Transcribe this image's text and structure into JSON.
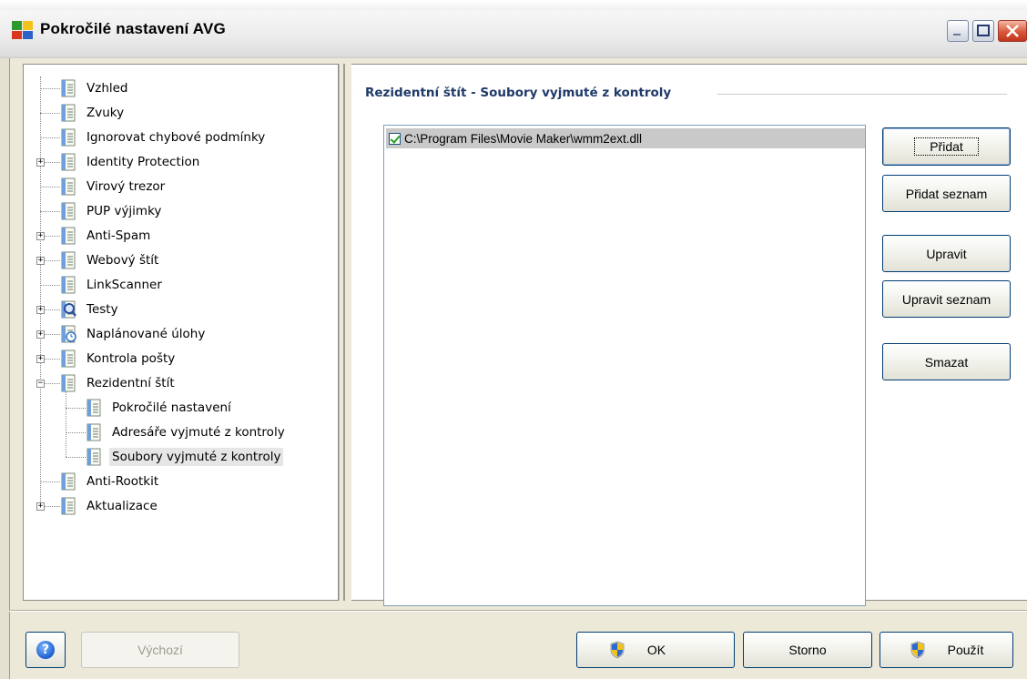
{
  "window": {
    "title": "Pokročilé nastavení AVG"
  },
  "tree": {
    "items": [
      {
        "label": "Vzhled",
        "level": 0,
        "icon": "settings-page-icon",
        "expandable": false
      },
      {
        "label": "Zvuky",
        "level": 0,
        "icon": "settings-page-icon",
        "expandable": false
      },
      {
        "label": "Ignorovat chybové podmínky",
        "level": 0,
        "icon": "settings-page-icon",
        "expandable": false
      },
      {
        "label": "Identity Protection",
        "level": 0,
        "icon": "settings-page-icon",
        "expandable": true,
        "expanded": false
      },
      {
        "label": "Virový trezor",
        "level": 0,
        "icon": "settings-page-icon",
        "expandable": false
      },
      {
        "label": "PUP výjimky",
        "level": 0,
        "icon": "settings-page-icon",
        "expandable": false
      },
      {
        "label": "Anti-Spam",
        "level": 0,
        "icon": "settings-page-icon",
        "expandable": true,
        "expanded": false
      },
      {
        "label": "Webový štít",
        "level": 0,
        "icon": "settings-page-icon",
        "expandable": true,
        "expanded": false
      },
      {
        "label": "LinkScanner",
        "level": 0,
        "icon": "settings-page-icon",
        "expandable": false
      },
      {
        "label": "Testy",
        "level": 0,
        "icon": "magnifier-icon",
        "expandable": true,
        "expanded": false
      },
      {
        "label": "Naplánované úlohy",
        "level": 0,
        "icon": "scheduler-icon",
        "expandable": true,
        "expanded": false
      },
      {
        "label": "Kontrola pošty",
        "level": 0,
        "icon": "settings-page-icon",
        "expandable": true,
        "expanded": false
      },
      {
        "label": "Rezidentní štít",
        "level": 0,
        "icon": "settings-page-icon",
        "expandable": true,
        "expanded": true
      },
      {
        "label": "Pokročilé nastavení",
        "level": 1,
        "icon": "settings-page-icon",
        "expandable": false
      },
      {
        "label": "Adresáře vyjmuté z kontroly",
        "level": 1,
        "icon": "settings-page-icon",
        "expandable": false
      },
      {
        "label": "Soubory vyjmuté z kontroly",
        "level": 1,
        "icon": "settings-page-icon",
        "expandable": false,
        "selected": true
      },
      {
        "label": "Anti-Rootkit",
        "level": 0,
        "icon": "settings-page-icon",
        "expandable": false
      },
      {
        "label": "Aktualizace",
        "level": 0,
        "icon": "settings-page-icon",
        "expandable": true,
        "expanded": false
      }
    ]
  },
  "content": {
    "section_title": "Rezidentní štít - Soubory vyjmuté z kontroly",
    "files": [
      {
        "path": "C:\\Program Files\\Movie Maker\\wmm2ext.dll",
        "checked": true
      }
    ],
    "buttons": {
      "add": "Přidat",
      "add_list": "Přidat seznam",
      "edit": "Upravit",
      "edit_list": "Upravit seznam",
      "delete": "Smazat"
    }
  },
  "footer": {
    "help_icon": "question-mark-icon",
    "defaults": "Výchozí",
    "ok": "OK",
    "cancel": "Storno",
    "apply": "Použít"
  },
  "colors": {
    "section_title": "#1f3a68",
    "selected_row": "#c9c9c9",
    "check": "#21a121"
  }
}
